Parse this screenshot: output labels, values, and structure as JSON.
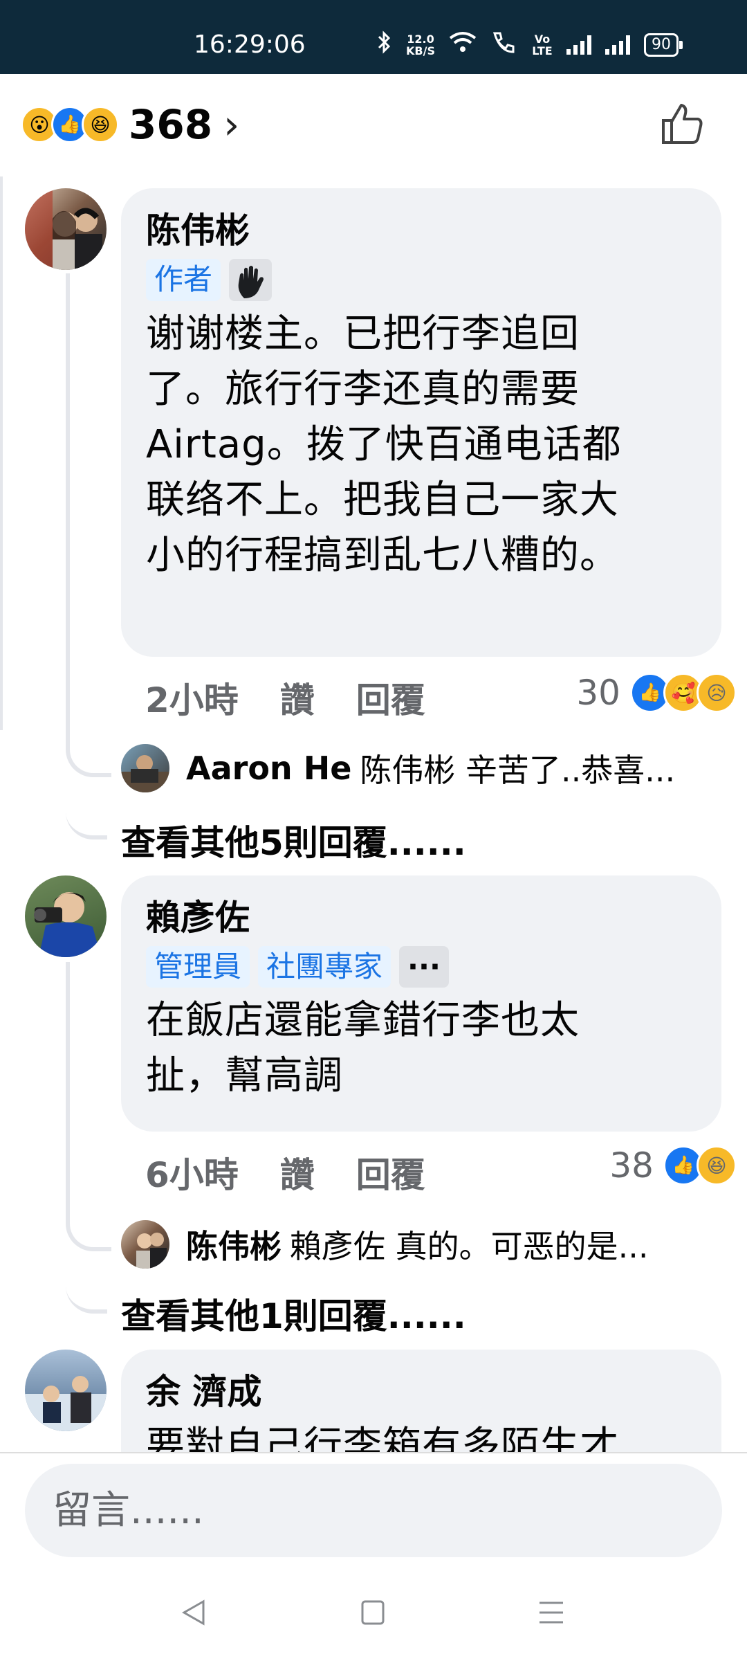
{
  "status": {
    "time": "16:29:06",
    "speed_value": "12.0",
    "speed_unit": "KB/S",
    "volte": "Vo LTE",
    "battery": "90"
  },
  "reactions": {
    "count": "368",
    "chevron": "›"
  },
  "comments": [
    {
      "author": "陈伟彬",
      "badges": [
        "作者"
      ],
      "text_lines": [
        "谢谢楼主。已把行李追回",
        "了。旅行行李还真的需要",
        "Airtag。拨了快百通电话都",
        "联络不上。把我自己一家大",
        "小的行程搞到乱七八糟的。"
      ],
      "time": "2小時",
      "like_label": "讚",
      "reply_label": "回覆",
      "reaction_count": "30",
      "reply_preview": {
        "name": "Aaron He",
        "text": "陈伟彬 辛苦了..恭喜..."
      },
      "more_replies": "查看其他5則回覆......"
    },
    {
      "author": "賴彥佐",
      "badges": [
        "管理員",
        "社團專家",
        "···"
      ],
      "text_lines": [
        "在飯店還能拿錯行李也太",
        "扯，幫高調"
      ],
      "time": "6小時",
      "like_label": "讚",
      "reply_label": "回覆",
      "reaction_count": "38",
      "reply_preview": {
        "name": "陈伟彬",
        "text": "賴彥佐 真的。可恶的是..."
      },
      "more_replies": "查看其他1則回覆......"
    },
    {
      "author": "余 濟成",
      "text_lines": [
        "要對自己行李箱有多陌生才"
      ]
    }
  ],
  "composer": {
    "placeholder": "留言......"
  },
  "colors": {
    "status_bar": "#0e2a3b",
    "like_blue": "#1877f2",
    "badge_blue": "#1b74e4",
    "bubble_bg": "#f0f2f5",
    "meta_grey": "#65676b"
  },
  "icons": [
    "bluetooth-icon",
    "wifi-icon",
    "call-icon",
    "signal-icon",
    "battery-icon",
    "wow-reaction-icon",
    "like-reaction-icon",
    "haha-reaction-icon",
    "thumbs-up-icon",
    "wave-icon",
    "love-reaction-icon",
    "sad-reaction-icon",
    "back-nav-icon",
    "home-nav-icon",
    "menu-nav-icon"
  ]
}
